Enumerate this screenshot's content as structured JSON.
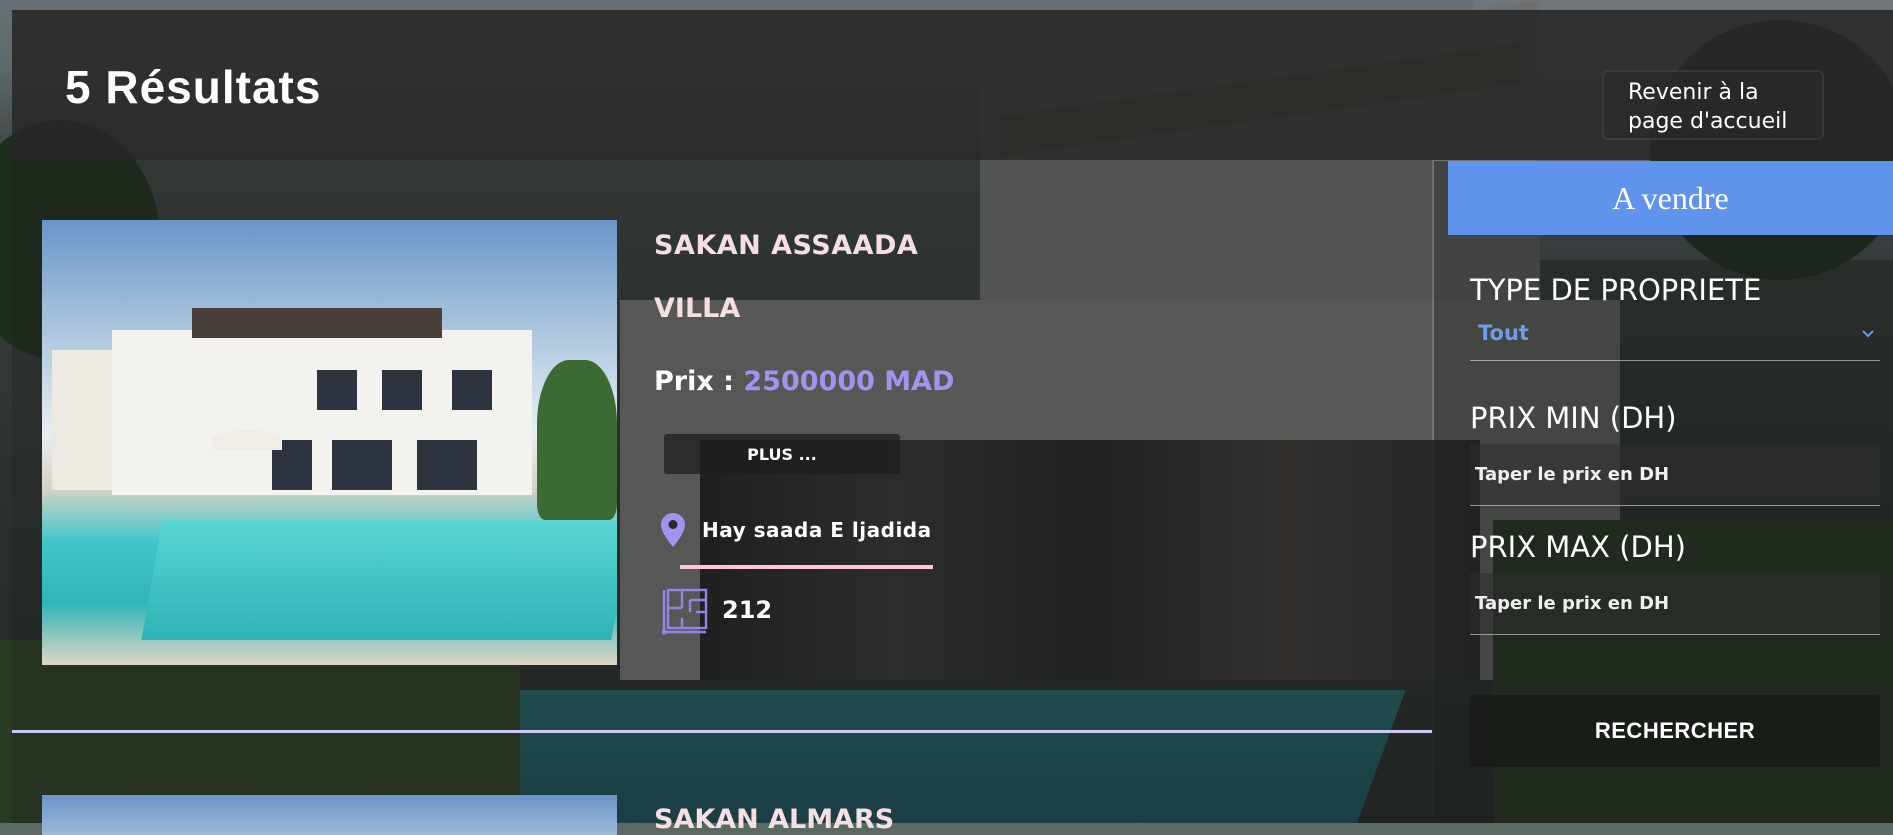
{
  "header": {
    "title": "5 Résultats",
    "back_label": "Revenir à la page d'accueil"
  },
  "listings": [
    {
      "name": "SAKAN ASSAADA",
      "type": "VILLA",
      "price_label": "Prix :",
      "price_value": "2500000 MAD",
      "more_label": "PLUS ...",
      "location": "Hay saada E ljadida",
      "area": "212"
    },
    {
      "name": "SAKAN ALMARS"
    }
  ],
  "filter": {
    "heading": "A vendre",
    "type_label": "TYPE DE PROPRIETE",
    "type_value": "Tout",
    "min_label": "PRIX MIN (DH)",
    "min_placeholder": "Taper le prix en DH",
    "max_label": "PRIX MAX (DH)",
    "max_placeholder": "Taper le prix en DH",
    "search_label": "RECHERCHER"
  },
  "colors": {
    "accent_blue": "#6093eb",
    "price_purple": "#9f94ef",
    "name_pink": "#f6dfe3",
    "underline_pink": "#ffc7d6"
  },
  "icons": [
    "map-pin-icon",
    "floor-plan-icon",
    "chevron-down-icon"
  ]
}
